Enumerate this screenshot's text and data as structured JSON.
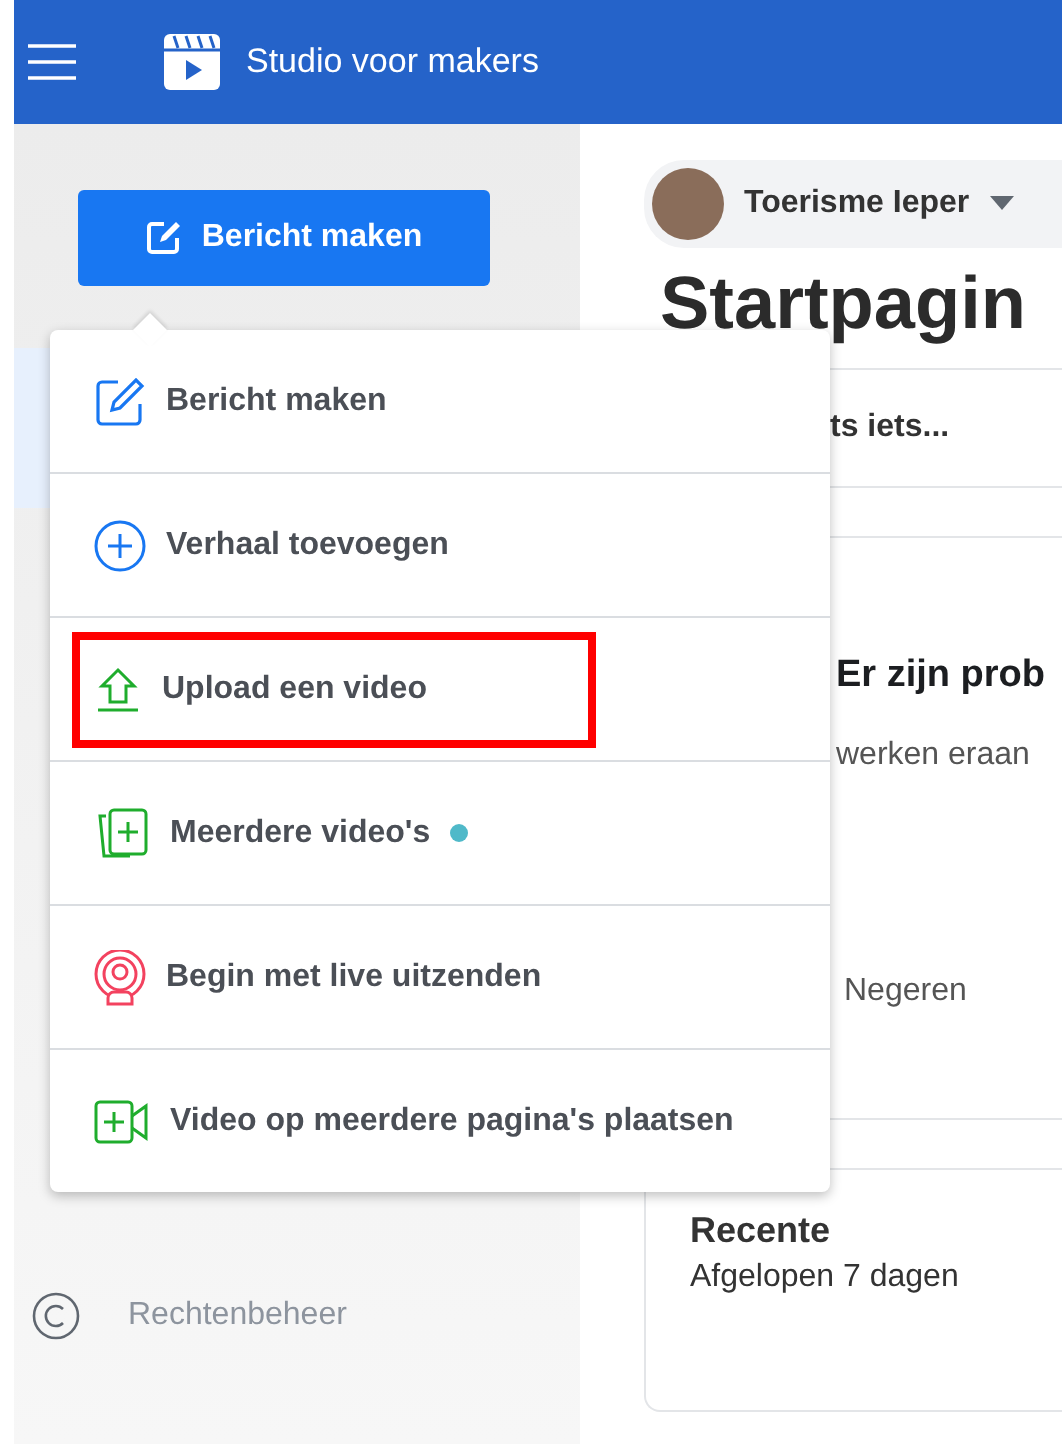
{
  "header": {
    "title": "Studio voor makers"
  },
  "sidebar": {
    "create_button": "Bericht maken",
    "items": [
      {
        "label": "Rechtenbeheer"
      }
    ]
  },
  "menu": {
    "items": [
      {
        "kind": "edit",
        "label": "Bericht maken",
        "highlighted": false,
        "new_dot": false
      },
      {
        "kind": "story",
        "label": "Verhaal toevoegen",
        "highlighted": false,
        "new_dot": false
      },
      {
        "kind": "upload",
        "label": "Upload een video",
        "highlighted": true,
        "new_dot": false
      },
      {
        "kind": "multi",
        "label": "Meerdere video's",
        "highlighted": false,
        "new_dot": true
      },
      {
        "kind": "live",
        "label": "Begin met live uitzenden",
        "highlighted": false,
        "new_dot": false
      },
      {
        "kind": "crosspost",
        "label": "Video op meerdere pagina's plaatsen",
        "highlighted": false,
        "new_dot": false
      }
    ]
  },
  "main": {
    "page_name": "Toerisme Ieper",
    "heading": "Startpagin",
    "composer_hint": "ts iets...",
    "alert_title": "Er zijn prob",
    "alert_text": "werken eraan",
    "alert_action": "Negeren",
    "recent_title": "Recente",
    "recent_period": "Afgelopen 7 dagen"
  }
}
